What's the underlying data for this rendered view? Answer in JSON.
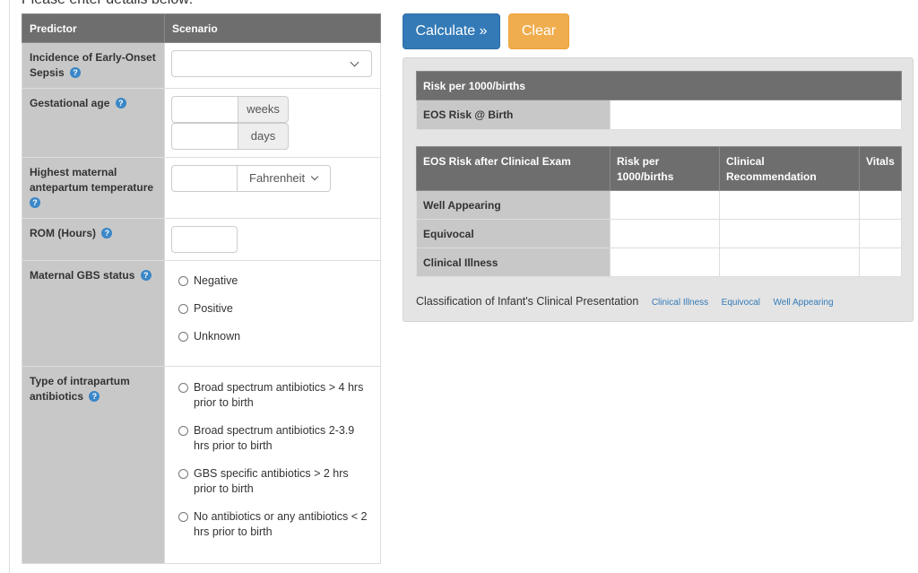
{
  "intro_text": "Please enter details below:",
  "table": {
    "headers": {
      "predictor": "Predictor",
      "scenario": "Scenario"
    },
    "incidence": {
      "label": "Incidence of Early-Onset Sepsis",
      "help": "?"
    },
    "gestational": {
      "label": "Gestational age",
      "help": "?",
      "weeks_unit": "weeks",
      "days_unit": "days"
    },
    "temperature": {
      "label": "Highest maternal antepartum temperature",
      "help": "?",
      "unit_selected": "Fahrenheit"
    },
    "rom": {
      "label": "ROM (Hours)",
      "help": "?"
    },
    "gbs": {
      "label": "Maternal GBS status",
      "help": "?",
      "options": [
        "Negative",
        "Positive",
        "Unknown"
      ]
    },
    "antibiotics": {
      "label": "Type of intrapartum antibiotics",
      "help": "?",
      "options": [
        "Broad spectrum antibiotics > 4 hrs prior to birth",
        "Broad spectrum antibiotics 2-3.9 hrs prior to birth",
        "GBS specific antibiotics > 2 hrs prior to birth",
        "No antibiotics or any antibiotics < 2 hrs prior to birth"
      ]
    }
  },
  "buttons": {
    "calculate": "Calculate »",
    "clear": "Clear"
  },
  "results": {
    "risk_header": "Risk per 1000/births",
    "birth_row_label": "EOS Risk @ Birth",
    "exam_headers": [
      "EOS Risk after Clinical Exam",
      "Risk per 1000/births",
      "Clinical Recommendation",
      "Vitals"
    ],
    "exam_rows": [
      "Well Appearing",
      "Equivocal",
      "Clinical Illness"
    ]
  },
  "legend": {
    "label": "Classification of Infant's Clinical Presentation",
    "links": [
      "Clinical Illness",
      "Equivocal",
      "Well Appearing"
    ]
  },
  "colors": {
    "header_bg": "#6e6e6e",
    "label_bg": "#c8c8c8",
    "primary": "#337ab7",
    "warning": "#f0ad4e",
    "panel_bg": "#e4e4e4",
    "help_icon": "#3a87c8"
  }
}
